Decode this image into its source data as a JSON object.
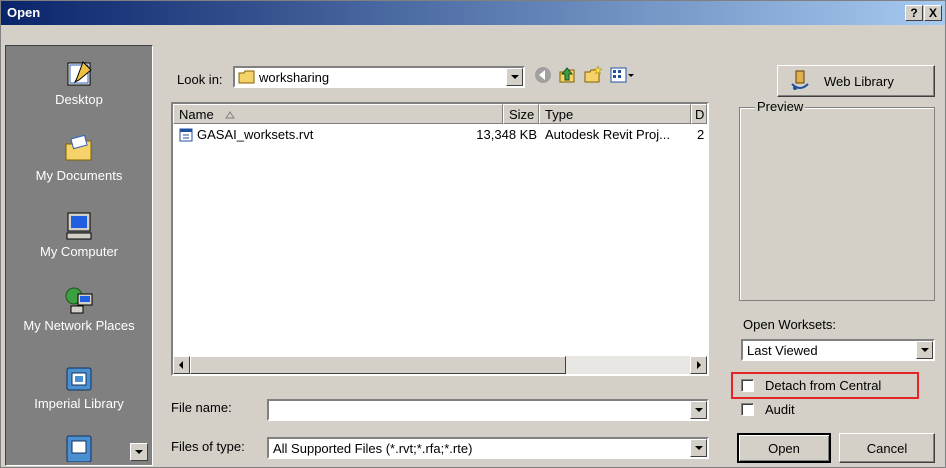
{
  "window": {
    "title": "Open",
    "help_label": "?",
    "close_label": "X"
  },
  "places": [
    {
      "label": "Desktop"
    },
    {
      "label": "My Documents"
    },
    {
      "label": "My Computer"
    },
    {
      "label": "My Network Places"
    },
    {
      "label": "Imperial Library"
    }
  ],
  "lookin": {
    "label": "Look in:",
    "value": "worksharing"
  },
  "web_library": {
    "label": "Web Library"
  },
  "filelist": {
    "columns": [
      "Name",
      "Size",
      "Type",
      "D"
    ],
    "rows": [
      {
        "name": "GASAI_worksets.rvt",
        "size": "13,348 KB",
        "type": "Autodesk Revit Proj...",
        "date": "2"
      }
    ]
  },
  "preview": {
    "label": "Preview"
  },
  "worksets": {
    "label": "Open Worksets:",
    "value": "Last Viewed"
  },
  "options": {
    "detach_label": "Detach from Central",
    "audit_label": "Audit"
  },
  "filename": {
    "label": "File name:",
    "value": ""
  },
  "filetype": {
    "label": "Files of type:",
    "value": "All Supported Files (*.rvt;*.rfa;*.rte)"
  },
  "buttons": {
    "open_label": "Open",
    "cancel_label": "Cancel"
  }
}
